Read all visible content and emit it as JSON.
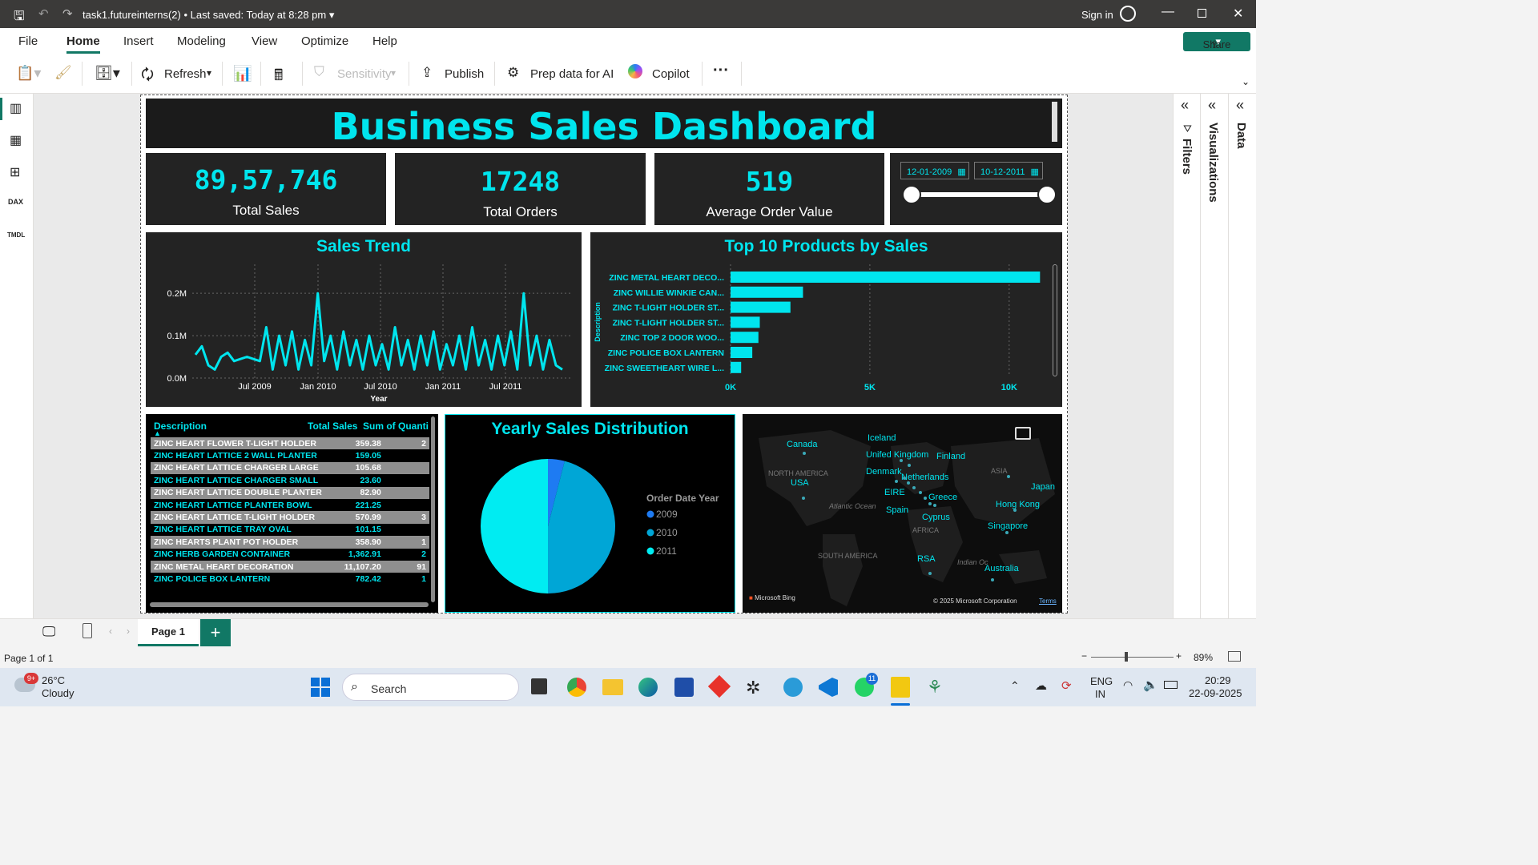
{
  "window": {
    "title": "task1.futureinterns(2)",
    "saved": "Last saved: Today at 8:28 pm",
    "sign_in": "Sign in"
  },
  "menu": [
    "File",
    "Home",
    "Insert",
    "Modeling",
    "View",
    "Optimize",
    "Help"
  ],
  "share_label": "Share",
  "ribbon": {
    "refresh": "Refresh",
    "sensitivity": "Sensitivity",
    "publish": "Publish",
    "prep": "Prep data for AI",
    "copilot": "Copilot"
  },
  "dashboard": {
    "title": "Business Sales Dashboard",
    "kpis": [
      {
        "value": "89,57,746",
        "label": "Total Sales"
      },
      {
        "value": "17248",
        "label": "Total Orders"
      },
      {
        "value": "519",
        "label": "Average Order Value"
      }
    ],
    "date_from": "12-01-2009",
    "date_to": "10-12-2011",
    "slider_value": 1.0
  },
  "chart_data": [
    {
      "type": "line",
      "title": "Sales Trend",
      "xlabel": "Year",
      "ylabel": "",
      "x_ticks": [
        "Jul 2009",
        "Jan 2010",
        "Jul 2010",
        "Jan 2011",
        "Jul 2011"
      ],
      "y_ticks": [
        "0.0M",
        "0.1M",
        "0.2M"
      ],
      "ylim": [
        0,
        0.24
      ],
      "grid": true,
      "x": [
        "2009-02",
        "2009-03",
        "2009-04",
        "2009-05",
        "2009-06",
        "2009-07",
        "2009-08",
        "2009-09",
        "2009-10",
        "2009-11",
        "2009-12",
        "2010-01",
        "2010-01b",
        "2010-02",
        "2010-02b",
        "2010-03",
        "2010-03b",
        "2010-04",
        "2010-04b",
        "2010-05",
        "2010-05b",
        "2010-06",
        "2010-06b",
        "2010-07",
        "2010-07b",
        "2010-08",
        "2010-08b",
        "2010-09",
        "2010-09b",
        "2010-10",
        "2010-10b",
        "2010-11",
        "2010-11b",
        "2010-12",
        "2010-12b",
        "2011-01",
        "2011-01b",
        "2011-02",
        "2011-02b",
        "2011-03",
        "2011-03b",
        "2011-04",
        "2011-04b",
        "2011-05",
        "2011-05b",
        "2011-06",
        "2011-06b",
        "2011-07",
        "2011-07b",
        "2011-08",
        "2011-08b",
        "2011-09",
        "2011-09b",
        "2011-10",
        "2011-10b",
        "2011-11",
        "2011-11b",
        "2011-12"
      ],
      "values": [
        0.055,
        0.075,
        0.03,
        0.02,
        0.05,
        0.06,
        0.04,
        0.045,
        0.05,
        0.045,
        0.04,
        0.12,
        0.02,
        0.1,
        0.03,
        0.11,
        0.02,
        0.09,
        0.03,
        0.2,
        0.04,
        0.1,
        0.02,
        0.11,
        0.03,
        0.09,
        0.02,
        0.1,
        0.03,
        0.08,
        0.02,
        0.12,
        0.03,
        0.09,
        0.02,
        0.1,
        0.03,
        0.11,
        0.02,
        0.08,
        0.03,
        0.1,
        0.02,
        0.12,
        0.03,
        0.09,
        0.02,
        0.1,
        0.03,
        0.11,
        0.02,
        0.2,
        0.03,
        0.1,
        0.02,
        0.09,
        0.03,
        0.02
      ]
    },
    {
      "type": "bar",
      "orientation": "horizontal",
      "title": "Top 10 Products by Sales",
      "ylabel": "Description",
      "x_ticks": [
        "0K",
        "5K",
        "10K"
      ],
      "xlim": [
        0,
        11500
      ],
      "grid": true,
      "categories": [
        "ZINC METAL HEART DECO...",
        "ZINC WILLIE WINKIE CAN...",
        "ZINC T-LIGHT HOLDER ST...",
        "ZINC T-LIGHT HOLDER ST...",
        "ZINC TOP 2 DOOR WOO...",
        "ZINC POLICE BOX LANTERN",
        "ZINC SWEETHEART WIRE L..."
      ],
      "values": [
        11107,
        2600,
        2150,
        1050,
        1000,
        780,
        380
      ]
    },
    {
      "type": "pie",
      "title": "Yearly Sales Distribution",
      "legend_title": "Order Date Year",
      "legend_position": "right",
      "categories": [
        "2009",
        "2010",
        "2011"
      ],
      "values": [
        4,
        46,
        50
      ],
      "colors": [
        "#1e7bf2",
        "#00a6d6",
        "#00ecf2"
      ]
    },
    {
      "type": "table",
      "columns": [
        "Description",
        "Total Sales",
        "Sum of Quanti"
      ],
      "rows": [
        [
          "ZINC HEART FLOWER T-LIGHT HOLDER",
          "359.38",
          "2"
        ],
        [
          "ZINC HEART LATTICE 2 WALL PLANTER",
          "159.05",
          ""
        ],
        [
          "ZINC HEART LATTICE CHARGER LARGE",
          "105.68",
          ""
        ],
        [
          "ZINC HEART LATTICE CHARGER SMALL",
          "23.60",
          ""
        ],
        [
          "ZINC HEART LATTICE DOUBLE PLANTER",
          "82.90",
          ""
        ],
        [
          "ZINC HEART LATTICE PLANTER BOWL",
          "221.25",
          ""
        ],
        [
          "ZINC HEART LATTICE T-LIGHT HOLDER",
          "570.99",
          "3"
        ],
        [
          "ZINC HEART LATTICE TRAY OVAL",
          "101.15",
          ""
        ],
        [
          "ZINC HEARTS PLANT POT HOLDER",
          "358.90",
          "1"
        ],
        [
          "ZINC HERB GARDEN CONTAINER",
          "1,362.91",
          "2"
        ],
        [
          "ZINC METAL HEART DECORATION",
          "11,107.20",
          "91"
        ],
        [
          "ZINC POLICE BOX LANTERN",
          "782.42",
          "1"
        ]
      ]
    }
  ],
  "map": {
    "labels": [
      "Canada",
      "Iceland",
      "Unifed Kingdom",
      "Finland",
      "Denmark",
      "NORTH AMERICA",
      "USA",
      "Netherlands",
      "ASIA",
      "Japan",
      "EIRE",
      "Greece",
      "Spain",
      "Hong Kong",
      "Cyprus",
      "AFRICA",
      "Singapore",
      "SOUTH AMERICA",
      "RSA",
      "Australia",
      "Atlantic Ocean",
      "Indian Oc"
    ],
    "attribution": "© 2025 Microsoft Corporation",
    "terms": "Terms",
    "bing": "Microsoft Bing"
  },
  "panes": [
    "Filters",
    "Visualizations",
    "Data"
  ],
  "pages": {
    "current": "Page 1",
    "status": "Page 1 of 1",
    "zoom": "89%"
  },
  "taskbar": {
    "temp": "26°C",
    "weather": "Cloudy",
    "weather_badge": "9+",
    "search": "Search",
    "lang1": "ENG",
    "lang2": "IN",
    "time": "20:29",
    "date": "22-09-2025",
    "whatsapp_badge": "11"
  },
  "colors": {
    "accent": "#00e5ee",
    "panel": "#232323",
    "share": "#117865"
  }
}
